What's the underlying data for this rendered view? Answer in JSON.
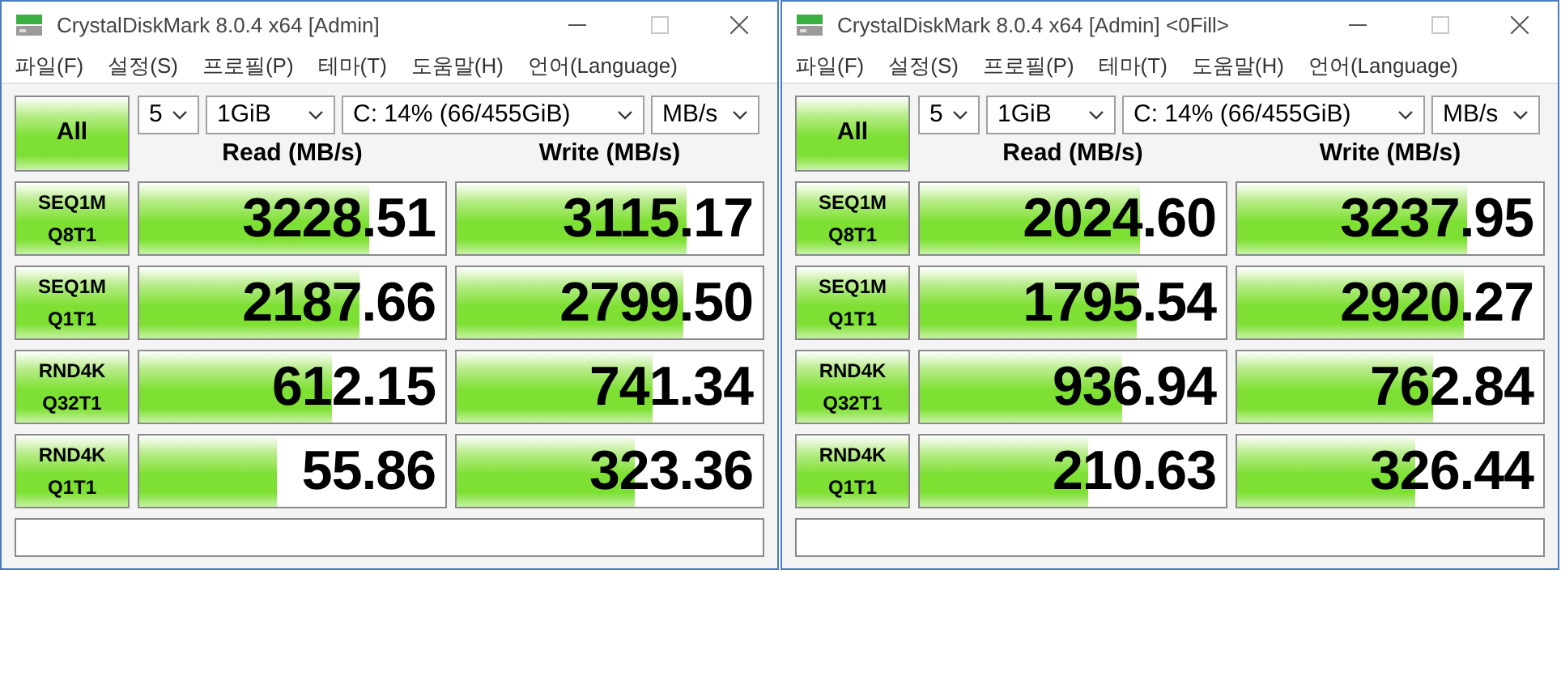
{
  "windows": [
    {
      "title": "CrystalDiskMark 8.0.4 x64 [Admin]",
      "menu": [
        "파일(F)",
        "설정(S)",
        "프로필(P)",
        "테마(T)",
        "도움말(H)",
        "언어(Language)"
      ],
      "all_button": "All",
      "selects": [
        "5",
        "1GiB",
        "C: 14% (66/455GiB)",
        "MB/s"
      ],
      "headers": [
        "Read (MB/s)",
        "Write (MB/s)"
      ],
      "rows": [
        {
          "label": [
            "SEQ1M",
            "Q8T1"
          ],
          "read": {
            "value": "3228.51",
            "level": 0.75
          },
          "write": {
            "value": "3115.17",
            "level": 0.75
          }
        },
        {
          "label": [
            "SEQ1M",
            "Q1T1"
          ],
          "read": {
            "value": "2187.66",
            "level": 0.72
          },
          "write": {
            "value": "2799.50",
            "level": 0.74
          }
        },
        {
          "label": [
            "RND4K",
            "Q32T1"
          ],
          "read": {
            "value": "612.15",
            "level": 0.63
          },
          "write": {
            "value": "741.34",
            "level": 0.64
          }
        },
        {
          "label": [
            "RND4K",
            "Q1T1"
          ],
          "read": {
            "value": "55.86",
            "level": 0.45
          },
          "write": {
            "value": "323.36",
            "level": 0.58
          }
        }
      ]
    },
    {
      "title": "CrystalDiskMark 8.0.4 x64 [Admin] <0Fill>",
      "menu": [
        "파일(F)",
        "설정(S)",
        "프로필(P)",
        "테마(T)",
        "도움말(H)",
        "언어(Language)"
      ],
      "all_button": "All",
      "selects": [
        "5",
        "1GiB",
        "C: 14% (66/455GiB)",
        "MB/s"
      ],
      "headers": [
        "Read (MB/s)",
        "Write (MB/s)"
      ],
      "rows": [
        {
          "label": [
            "SEQ1M",
            "Q8T1"
          ],
          "read": {
            "value": "2024.60",
            "level": 0.72
          },
          "write": {
            "value": "3237.95",
            "level": 0.75
          }
        },
        {
          "label": [
            "SEQ1M",
            "Q1T1"
          ],
          "read": {
            "value": "1795.54",
            "level": 0.71
          },
          "write": {
            "value": "2920.27",
            "level": 0.74
          }
        },
        {
          "label": [
            "RND4K",
            "Q32T1"
          ],
          "read": {
            "value": "936.94",
            "level": 0.66
          },
          "write": {
            "value": "762.84",
            "level": 0.64
          }
        },
        {
          "label": [
            "RND4K",
            "Q1T1"
          ],
          "read": {
            "value": "210.63",
            "level": 0.55
          },
          "write": {
            "value": "326.44",
            "level": 0.58
          }
        }
      ]
    }
  ]
}
